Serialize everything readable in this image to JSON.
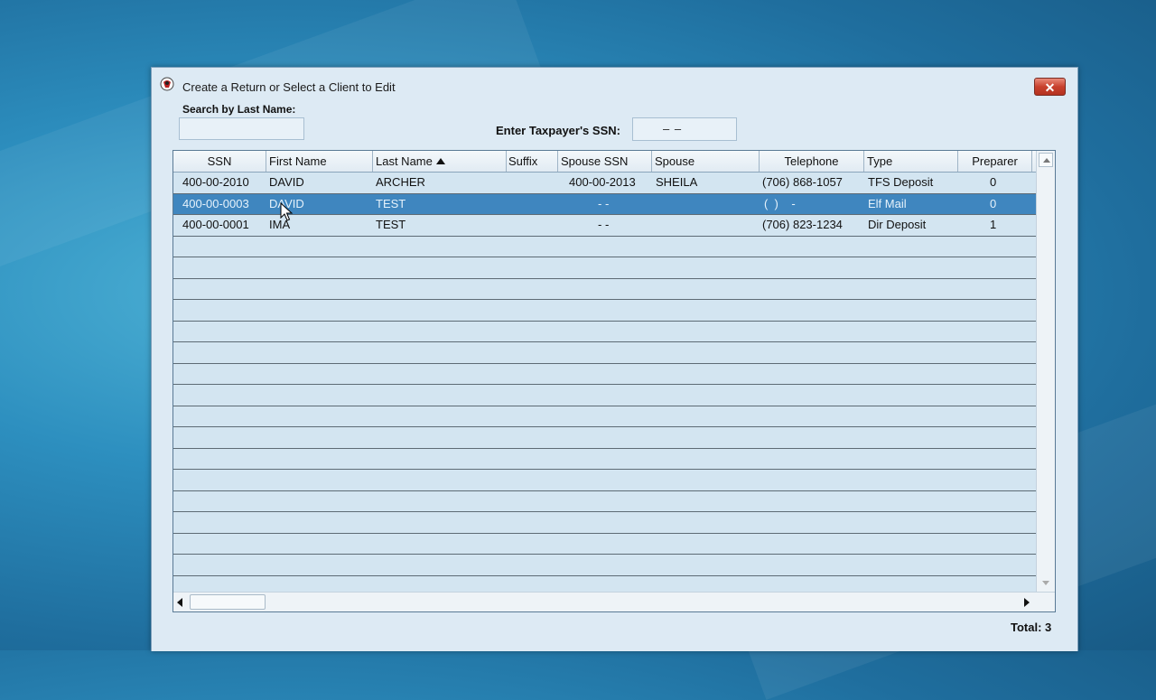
{
  "window": {
    "title": "Create a Return or Select a Client to Edit",
    "close_label": "✕"
  },
  "search": {
    "last_name_label": "Search by Last Name:",
    "last_name_value": "",
    "ssn_label": "Enter Taxpayer's SSN:",
    "ssn_value": "–   –"
  },
  "table": {
    "columns": [
      "SSN",
      "First Name",
      "Last Name",
      "Suffix",
      "Spouse SSN",
      "Spouse",
      "Telephone",
      "Type",
      "Preparer"
    ],
    "sorted_column": "Last Name",
    "sort_direction": "ascending",
    "rows": [
      {
        "ssn": "400-00-2010",
        "first": "DAVID",
        "last": "ARCHER",
        "suffix": "",
        "spouse_ssn": "400-00-2013",
        "spouse": "SHEILA",
        "phone": "(706) 868-1057",
        "type": "TFS Deposit",
        "preparer": "0",
        "selected": false
      },
      {
        "ssn": "400-00-0003",
        "first": "DAVID",
        "last": "TEST",
        "suffix": "",
        "spouse_ssn": "- -",
        "spouse": "",
        "phone": "(  )    -",
        "type": "Elf Mail",
        "preparer": "0",
        "selected": true
      },
      {
        "ssn": "400-00-0001",
        "first": "IMA",
        "last": "TEST",
        "suffix": "",
        "spouse_ssn": "- -",
        "spouse": "",
        "phone": "(706) 823-1234",
        "type": "Dir Deposit",
        "preparer": "1",
        "selected": false
      }
    ],
    "empty_rows": 17
  },
  "footer": {
    "total_label": "Total: 3"
  },
  "colors": {
    "selected_row": "#3f86bf",
    "row_background": "#d3e5f1",
    "window_background": "#ddeaf4"
  }
}
